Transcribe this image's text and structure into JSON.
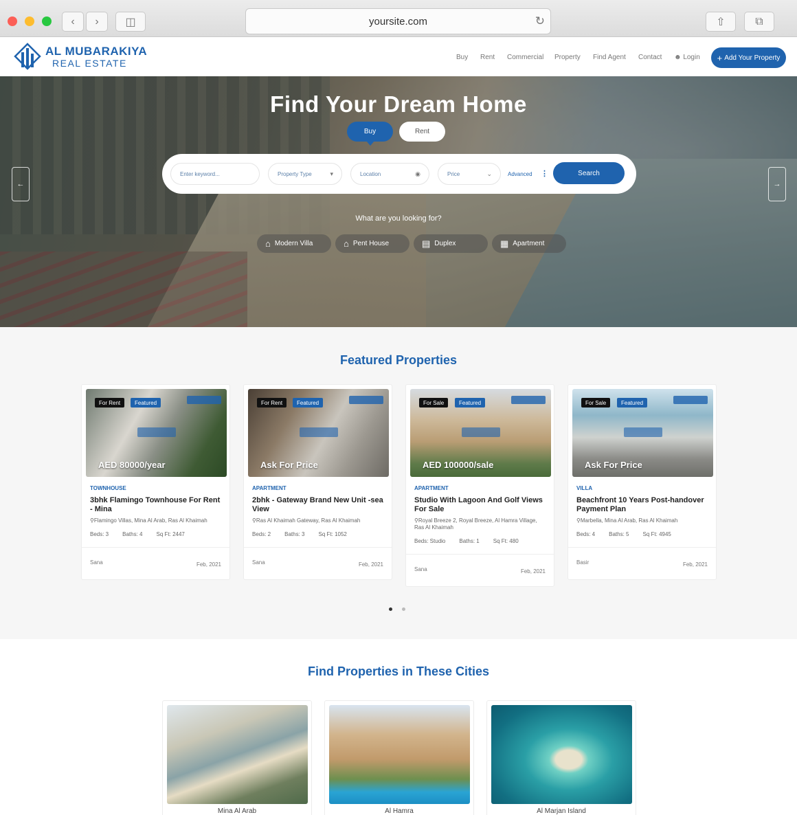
{
  "browser": {
    "url": "yoursite.com"
  },
  "nav": {
    "logo_line1": "AL MUBARAKIYA",
    "logo_line2": "REAL ESTATE",
    "items": [
      "Buy",
      "Rent",
      "Commercial",
      "Property",
      "Find Agent",
      "Contact"
    ],
    "login": "Login",
    "add_property": "Add Your Property"
  },
  "hero": {
    "title": "Find Your Dream Home",
    "tabs": [
      "Buy",
      "Rent"
    ],
    "search": {
      "keyword_placeholder": "Enter keyword...",
      "property_type": "Property Type",
      "location": "Location",
      "price": "Price",
      "advanced": "Advanced",
      "button": "Search"
    },
    "looking_for": "What are you looking for?",
    "categories": [
      "Modern Villa",
      "Pent House",
      "Duplex",
      "Apartment"
    ]
  },
  "featured": {
    "title": "Featured Properties",
    "cards": [
      {
        "status": "For Rent",
        "featured": "Featured",
        "price": "AED 80000/year",
        "type": "TOWNHOUSE",
        "title": "3bhk Flamingo Townhouse For Rent - Mina",
        "address": "Flamingo Villas, Mina Al Arab, Ras Al Khaimah",
        "beds": "Beds: 3",
        "baths": "Baths: 4",
        "sqft": "Sq Ft: 2447",
        "agent": "Sana",
        "date": "Feb, 2021"
      },
      {
        "status": "For Rent",
        "featured": "Featured",
        "price": "Ask For Price",
        "type": "APARTMENT",
        "title": "2bhk - Gateway Brand New Unit -sea View",
        "address": "Ras Al Khaimah Gateway, Ras Al Khaimah",
        "beds": "Beds: 2",
        "baths": "Baths: 3",
        "sqft": "Sq Ft: 1052",
        "agent": "Sana",
        "date": "Feb, 2021"
      },
      {
        "status": "For Sale",
        "featured": "Featured",
        "price": "AED 100000/sale",
        "type": "APARTMENT",
        "title": "Studio With Lagoon And Golf Views For Sale",
        "address": "Royal Breeze 2, Royal Breeze, Al Hamra Village, Ras Al Khaimah",
        "beds": "Beds: Studio",
        "baths": "Baths: 1",
        "sqft": "Sq Ft: 480",
        "agent": "Sana",
        "date": "Feb, 2021"
      },
      {
        "status": "For Sale",
        "featured": "Featured",
        "price": "Ask For Price",
        "type": "VILLA",
        "title": "Beachfront 10 Years Post-handover Payment Plan",
        "address": "Marbella, Mina Al Arab, Ras Al Khaimah",
        "beds": "Beds: 4",
        "baths": "Baths: 5",
        "sqft": "Sq Ft: 4945",
        "agent": "Basir",
        "date": "Feb, 2021"
      }
    ],
    "active_page": 1,
    "pages": 2
  },
  "cities": {
    "title": "Find Properties in These Cities",
    "items": [
      "Mina Al Arab",
      "Al Hamra",
      "Al Marjan Island"
    ]
  },
  "colors": {
    "brand": "#1f63ae",
    "badge_dark": "#111111"
  }
}
